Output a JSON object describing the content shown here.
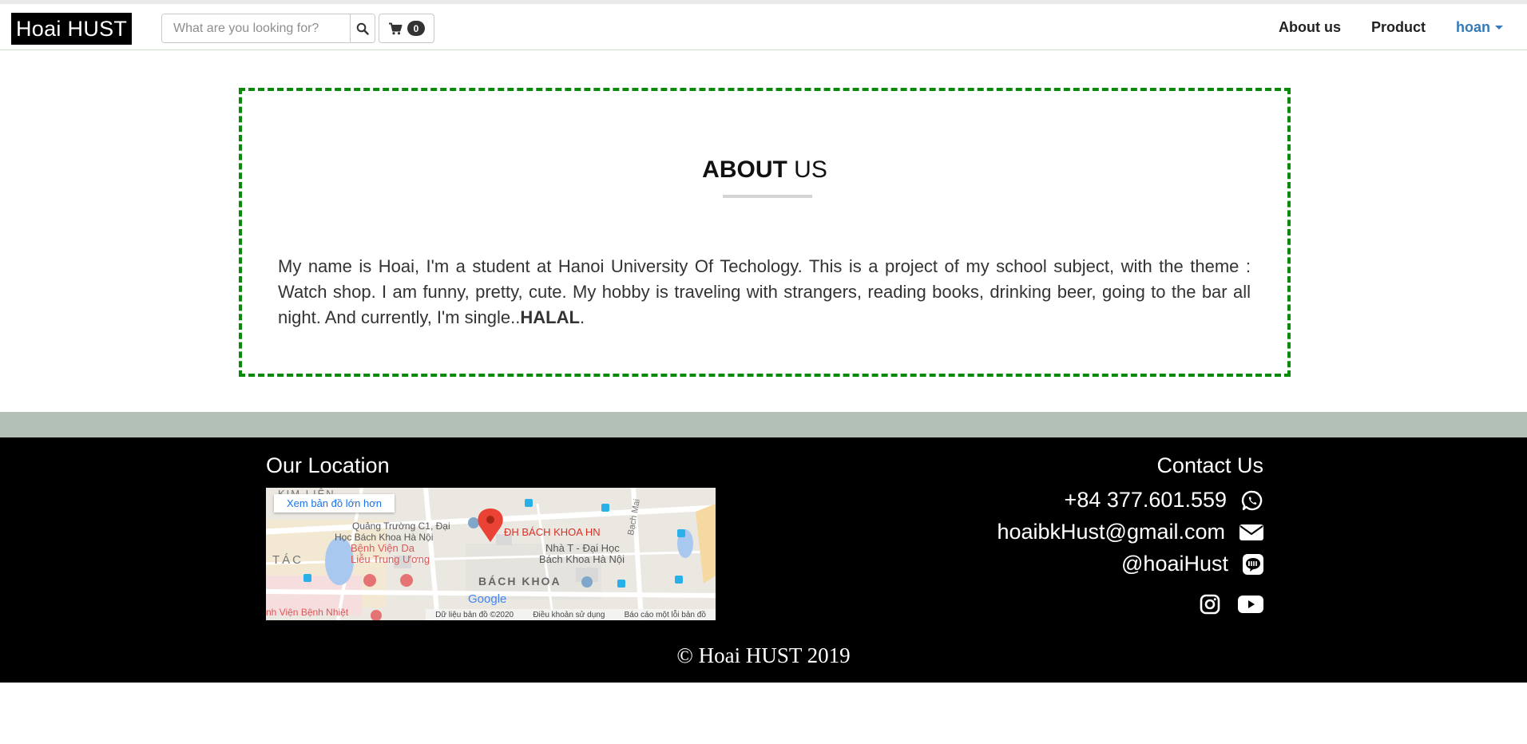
{
  "navbar": {
    "brand": "Hoai HUST",
    "search_placeholder": "What are you looking for?",
    "search_icon": "search-icon",
    "cart_icon": "cart-icon",
    "cart_count": "0",
    "links": [
      "About us",
      "Product"
    ],
    "user": "hoan"
  },
  "about": {
    "title_bold": "ABOUT",
    "title_rest": " US",
    "text": "My name is Hoai, I'm a student at Hanoi University Of Techology. This is a project of my school subject, with the theme : Watch shop. I am funny, pretty, cute. My hobby is traveling with strangers, reading books, drinking beer, going to the bar all night. And currently, I'm single..",
    "text_bold": "HALAL",
    "text_end": "."
  },
  "footer": {
    "location_title": "Our Location",
    "map_link": "Xem bản đồ lớn hơn",
    "map_labels": {
      "place": "ĐH BÁCH KHOA HN",
      "square": "Quảng Trường C1, Đại",
      "square2": "Học Bách Khoa Hà Nội",
      "hospital": "Bệnh Viện Da",
      "hospital2": "Liễu Trung Ương",
      "nha_t": "Nhà T - Đại Học",
      "nha_t2": "Bách Khoa Hà Nội",
      "district": "BÁCH KHOA",
      "kim_lien": "KIM LIÊN",
      "tac": "TÁC",
      "bach_mai": "Bạch Mai",
      "benh_nhiet": "nh Viện Bệnh Nhiệt",
      "google": "Google"
    },
    "map_footer": [
      "Dữ liệu bản đồ ©2020",
      "Điều khoản sử dụng",
      "Báo cáo một lỗi bản đồ"
    ],
    "contact_title": "Contact Us",
    "contacts": [
      {
        "text": "+84 377.601.559",
        "icon": "whatsapp-icon"
      },
      {
        "text": "hoaibkHust@gmail.com",
        "icon": "envelope-icon"
      },
      {
        "text": "@hoaiHust",
        "icon": "line-icon"
      }
    ],
    "social_icons": [
      "instagram-icon",
      "youtube-icon"
    ],
    "copyright": "©  Hoai HUST 2019"
  }
}
